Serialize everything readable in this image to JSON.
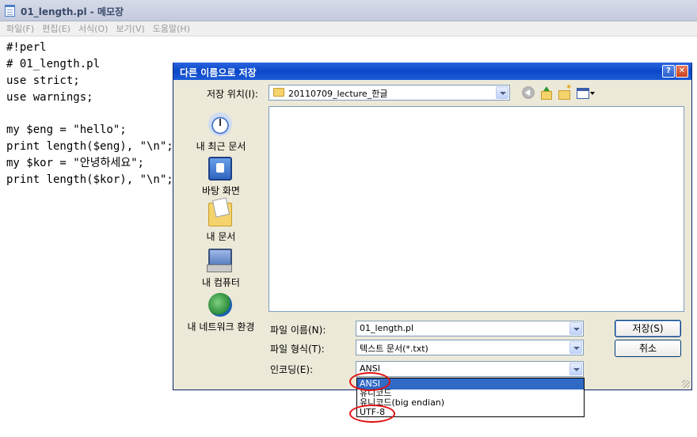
{
  "notepad": {
    "title": "01_length.pl - 메모장",
    "menu": [
      "파일(F)",
      "편집(E)",
      "서식(O)",
      "보기(V)",
      "도움말(H)"
    ],
    "lines": [
      "#!perl",
      "# 01_length.pl",
      "use strict;",
      "use warnings;",
      "",
      "my $eng = \"hello\";",
      "print length($eng), \"\\n\";",
      "my $kor = \"안녕하세요\";",
      "print length($kor), \"\\n\";"
    ]
  },
  "dialog": {
    "title": "다른 이름으로 저장",
    "help_glyph": "?",
    "close_glyph": "✕",
    "save_in_label": "저장 위치(I):",
    "save_in_value": "20110709_lecture_한글",
    "toolbar_icons": [
      "back-icon",
      "up-folder-icon",
      "new-folder-icon",
      "views-menu-icon"
    ],
    "places": [
      "내 최근 문서",
      "바탕 화면",
      "내 문서",
      "내 컴퓨터",
      "내 네트워크 환경"
    ],
    "filename_label": "파일 이름(N):",
    "filename_value": "01_length.pl",
    "filetype_label": "파일 형식(T):",
    "filetype_value": "텍스트 문서(*.txt)",
    "encoding_label": "인코딩(E):",
    "encoding_value": "ANSI",
    "save_button": "저장(S)",
    "cancel_button": "취소",
    "encoding_options": [
      "ANSI",
      "유니코드",
      "유니코드(big endian)",
      "UTF-8"
    ],
    "selected_option": "ANSI",
    "annotation_color": "#e01010"
  }
}
